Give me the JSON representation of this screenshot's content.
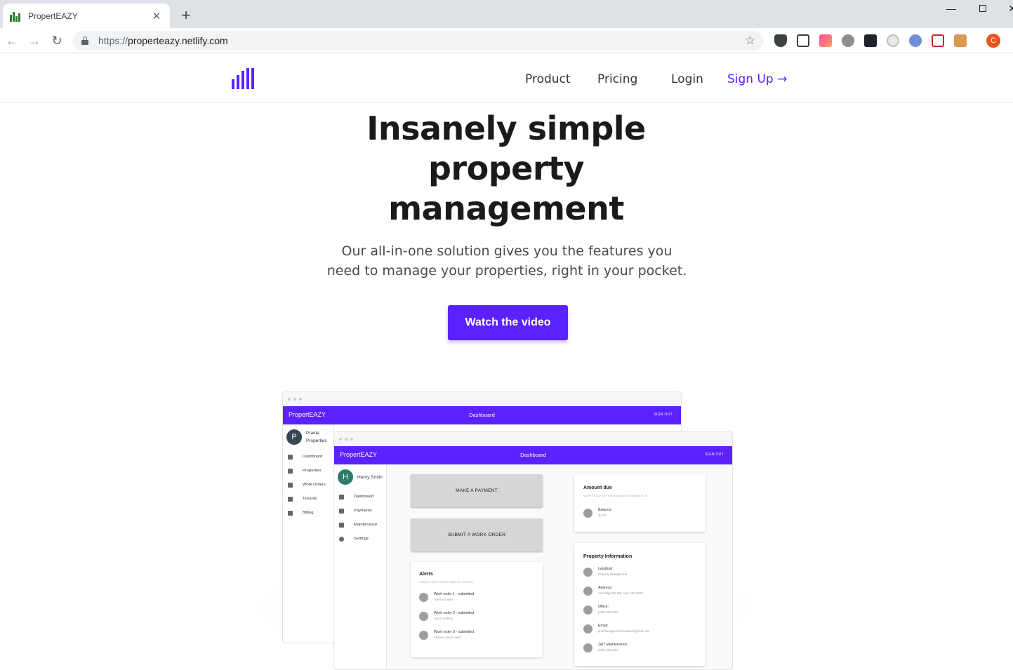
{
  "browser": {
    "tab_title": "PropertEAZY",
    "tab_close": "✕",
    "new_tab": "+",
    "url_scheme": "https://",
    "url_host": "properteazy.netlify.com",
    "profile_initial": "C",
    "window_controls": {
      "minimize": "—",
      "close": "✕"
    },
    "nav": {
      "back": "←",
      "forward": "→",
      "reload": "↻",
      "star": "☆"
    },
    "extensions": [
      "pocket-icon",
      "screenshot-icon",
      "color-icon",
      "tomato-icon",
      "react-devtools-icon",
      "pointer-icon",
      "info-icon",
      "shield-icon",
      "notes-icon"
    ]
  },
  "site": {
    "nav": {
      "product": "Product",
      "pricing": "Pricing",
      "login": "Login",
      "signup": "Sign Up →"
    },
    "hero": {
      "title": "Insanely simple property management",
      "subtitle": "Our all-in-one solution gives you the features you need to manage your properties, right in your pocket.",
      "cta": "Watch the video"
    },
    "brand_color": "#5b21ff"
  },
  "mock_back": {
    "brand": "PropertEAZY",
    "title": "Dashboard",
    "signout": "SIGN OUT",
    "avatar_initial": "P",
    "user": "Prairie Properties",
    "menu": [
      "Dashboard",
      "Properties",
      "Work Orders",
      "Tenants",
      "Billing"
    ]
  },
  "mock_front": {
    "brand": "PropertEAZY",
    "title": "Dashboard",
    "signout": "SIGN OUT",
    "avatar_initial": "H",
    "user": "Henry Smith",
    "menu": [
      "Dashboard",
      "Payments",
      "Maintenance",
      "Settings"
    ],
    "buttons": {
      "payment": "MAKE A PAYMENT",
      "work_order": "SUBMIT A WORK ORDER"
    },
    "alerts": {
      "title": "Alerts",
      "subtitle": "CHECK YOUR WORK ORDERS STATUS",
      "items": [
        {
          "title": "Work order 1 - submitted",
          "text": "Toilet is broken"
        },
        {
          "title": "Work order 2 - submitted",
          "text": "Sink is leaking"
        },
        {
          "title": "Work order 3 - submitted",
          "text": "Shower doesn't work"
        }
      ]
    },
    "amount_due": {
      "title": "Amount due",
      "subtitle": "KEEP TRACK OF YOUR MONTHLY PAYMENTS",
      "balance_label": "Balance:",
      "balance_value": "$ 0.00"
    },
    "property_info": {
      "title": "Property Information",
      "items": [
        {
          "title": "Landlord:",
          "text": "Property Management"
        },
        {
          "title": "Address:",
          "text": "Vail Ridge Rd 106, Vail, CO 52023"
        },
        {
          "title": "Office:",
          "text": "(432) 222-3432"
        },
        {
          "title": "Email:",
          "text": "propmanagementofvailrear@gmail.com"
        },
        {
          "title": "24/7 Maintenance:",
          "text": "(332) 223-4323"
        }
      ]
    }
  }
}
